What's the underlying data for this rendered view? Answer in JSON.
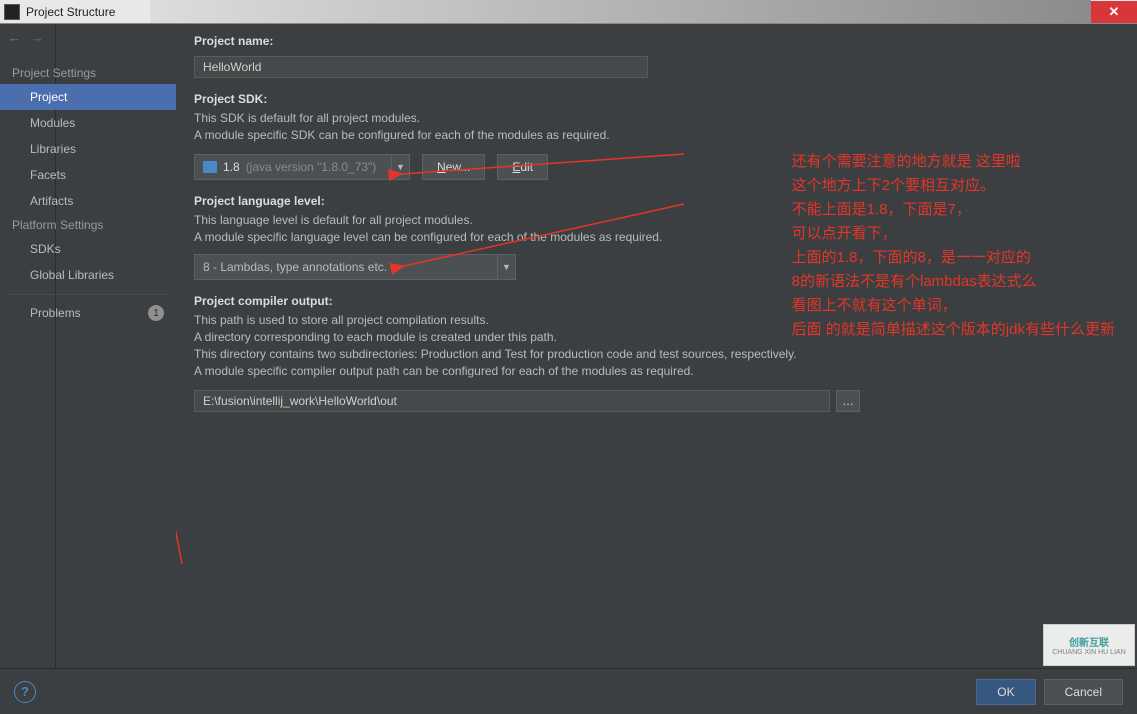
{
  "titlebar": {
    "title": "Project Structure"
  },
  "sidebar": {
    "section1": "Project Settings",
    "items1": [
      "Project",
      "Modules",
      "Libraries",
      "Facets",
      "Artifacts"
    ],
    "selected": "Project",
    "section2": "Platform Settings",
    "items2": [
      "SDKs",
      "Global Libraries"
    ],
    "problems_label": "Problems",
    "problems_count": "1"
  },
  "main": {
    "project_name_label": "Project name:",
    "project_name_value": "HelloWorld",
    "sdk_label": "Project SDK:",
    "sdk_desc1": "This SDK is default for all project modules.",
    "sdk_desc2": "A module specific SDK can be configured for each of the modules as required.",
    "sdk_value_version": "1.8",
    "sdk_value_detail": "(java version \"1.8.0_73\")",
    "new_btn": "New...",
    "edit_btn": "Edit",
    "lang_label": "Project language level:",
    "lang_desc1": "This language level is default for all project modules.",
    "lang_desc2": "A module specific language level can be configured for each of the modules as required.",
    "lang_value": "8 - Lambdas, type annotations etc.",
    "output_label": "Project compiler output:",
    "output_desc1": "This path is used to store all project compilation results.",
    "output_desc2": "A directory corresponding to each module is created under this path.",
    "output_desc3": "This directory contains two subdirectories: Production and Test for production code and test sources, respectively.",
    "output_desc4": "A module specific compiler output path can be configured for each of the modules as required.",
    "output_value": "E:\\fusion\\intellij_work\\HelloWorld\\out"
  },
  "annotations": {
    "line1": "还有个需要注意的地方就是 这里啦",
    "line2": "这个地方上下2个要相互对应。",
    "line3": "不能上面是1.8，下面是7，",
    "line4": "可以点开看下，",
    "line5": "上面的1.8，下面的8，是一一对应的",
    "line6": "8的新语法不是有个lambdas表达式么",
    "line7": "看图上不就有这个单词，",
    "line8": "后面 的就是简单描述这个版本的jdk有些什么更新"
  },
  "bottombar": {
    "ok": "OK",
    "cancel": "Cancel"
  },
  "watermark": {
    "brand": "创新互联"
  }
}
